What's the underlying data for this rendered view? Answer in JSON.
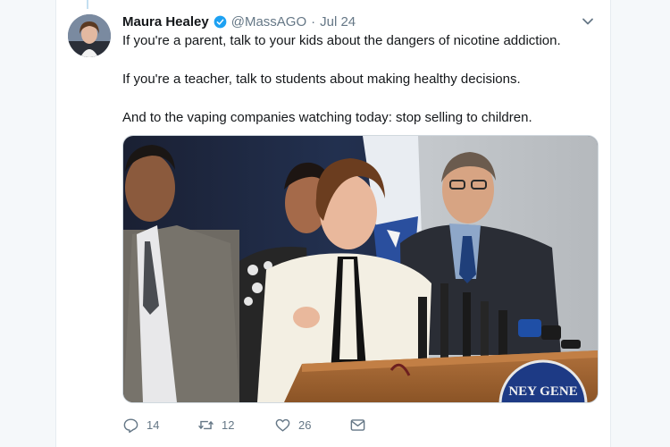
{
  "tweet": {
    "author_name": "Maura Healey",
    "handle": "@MassAGO",
    "separator": "·",
    "date": "Jul 24",
    "paragraphs": [
      "If you're a parent, talk to your kids about the dangers of nicotine addiction.",
      "If you're a teacher, talk to students about making healthy decisions.",
      "And to the vaping companies watching today: stop selling to children."
    ],
    "podium_seal_text": "NEY GENE"
  },
  "actions": {
    "reply_count": "14",
    "retweet_count": "12",
    "like_count": "26"
  },
  "icons": {
    "verified": "verified-badge-icon",
    "caret": "chevron-down-icon",
    "reply": "reply-icon",
    "retweet": "retweet-icon",
    "like": "heart-icon",
    "dm": "envelope-icon"
  },
  "colors": {
    "accent": "#1da1f2",
    "text": "#14171a",
    "muted": "#657786"
  }
}
